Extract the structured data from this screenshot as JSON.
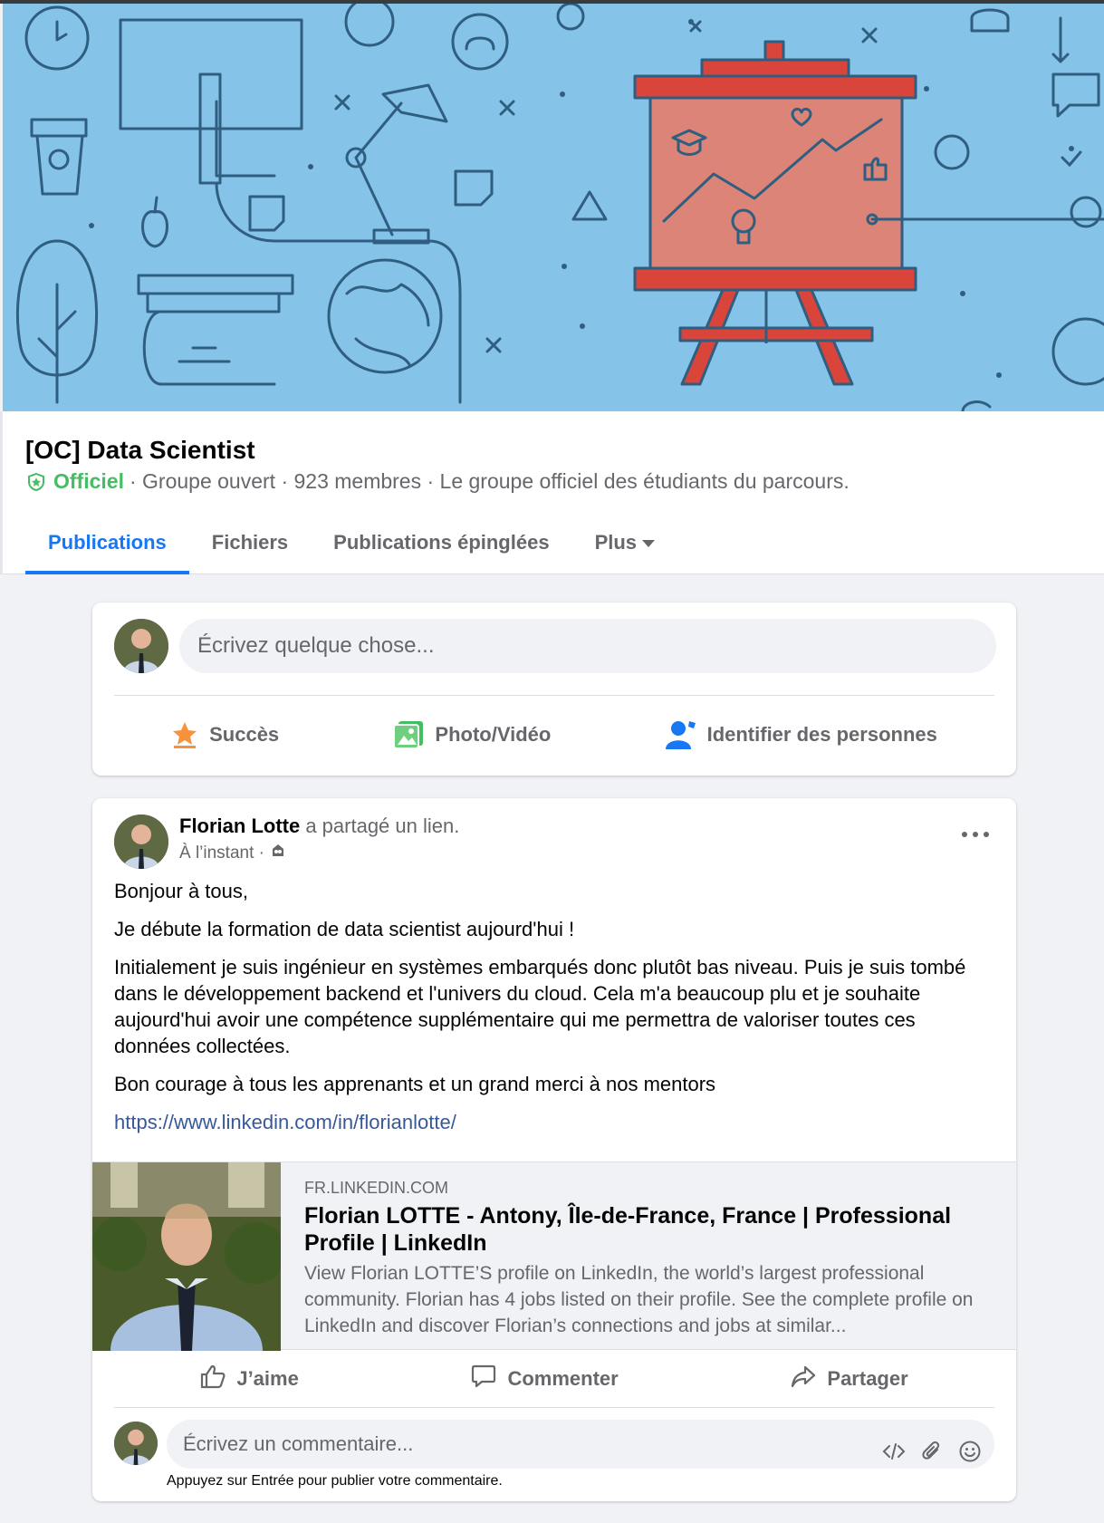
{
  "group": {
    "title": "[OC] Data Scientist",
    "official_label": "Officiel",
    "meta": "· Groupe ouvert · 923 membres · Le groupe officiel des étudiants du parcours."
  },
  "tabs": [
    {
      "label": "Publications",
      "active": true
    },
    {
      "label": "Fichiers"
    },
    {
      "label": "Publications épinglées"
    },
    {
      "label": "Plus"
    }
  ],
  "composer": {
    "placeholder": "Écrivez quelque chose...",
    "actions": {
      "success": "Succès",
      "photo": "Photo/Vidéo",
      "tag": "Identifier des personnes"
    }
  },
  "post": {
    "author": "Florian Lotte",
    "action_text": " a partagé un lien.",
    "time": "À l’instant ·",
    "paragraphs": [
      "Bonjour à tous,",
      "Je débute la formation de data scientist aujourd'hui !",
      "Initialement je suis ingénieur en systèmes embarqués donc plutôt bas niveau. Puis je suis tombé dans le développement backend et l'univers du cloud. Cela m'a beaucoup plu et je souhaite aujourd'hui avoir une compétence supplémentaire qui me permettra de valoriser toutes ces données collectées.",
      "Bon courage à tous les apprenants et un grand merci à nos mentors"
    ],
    "link": "https://www.linkedin.com/in/florianlotte/",
    "preview": {
      "domain": "FR.LINKEDIN.COM",
      "title": "Florian LOTTE - Antony, Île-de-France, France | Professional Profile | LinkedIn",
      "description": "View Florian LOTTE’S profile on LinkedIn, the world’s largest professional community. Florian has 4 jobs listed on their profile. See the complete profile on LinkedIn and discover Florian’s connections and jobs at similar..."
    },
    "actions": {
      "like": "J’aime",
      "comment": "Commenter",
      "share": "Partager"
    },
    "comment": {
      "placeholder": "Écrivez un commentaire...",
      "hint": "Appuyez sur Entrée pour publier votre commentaire."
    }
  },
  "colors": {
    "accent": "#1877f2",
    "official": "#45bd62",
    "cover_bg": "#86c3e9",
    "easel": "#d9443b"
  }
}
